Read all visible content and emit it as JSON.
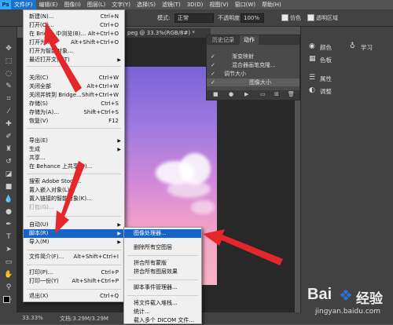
{
  "menubar": {
    "logo": "Ps",
    "items": [
      "文件(F)",
      "编辑(E)",
      "图像(I)",
      "图层(L)",
      "文字(Y)",
      "选择(S)",
      "滤镜(T)",
      "3D(D)",
      "视图(V)",
      "窗口(W)",
      "帮助(H)"
    ]
  },
  "optbar": {
    "mode_label": "模式:",
    "mode_value": "正常",
    "opacity_label": "不透明度:",
    "opacity_value": "100%",
    "protect_label": "仿色",
    "transparent_label": "透明区域"
  },
  "document_tab": "peg @ 33.3%(RGB/8#) *",
  "status": {
    "zoom": "33.33%",
    "doc": "文档:3.29M/3.29M"
  },
  "file_menu": [
    {
      "label": "新建(N)...",
      "shortcut": "Ctrl+N"
    },
    {
      "label": "打开(O)...",
      "shortcut": "Ctrl+O"
    },
    {
      "label": "在 Bridge 中浏览(B)...",
      "shortcut": "Alt+Ctrl+O"
    },
    {
      "label": "打开为...",
      "shortcut": "Alt+Shift+Ctrl+O"
    },
    {
      "label": "打开为智能对象...",
      "shortcut": ""
    },
    {
      "label": "最近打开文件(T)",
      "shortcut": "",
      "submenu": true
    },
    {
      "label": "关闭(C)",
      "shortcut": "Ctrl+W"
    },
    {
      "label": "关闭全部",
      "shortcut": "Alt+Ctrl+W"
    },
    {
      "label": "关闭并转到 Bridge...",
      "shortcut": "Shift+Ctrl+W"
    },
    {
      "label": "存储(S)",
      "shortcut": "Ctrl+S"
    },
    {
      "label": "存储为(A)...",
      "shortcut": "Shift+Ctrl+S"
    },
    {
      "label": "恢复(V)",
      "shortcut": "F12"
    },
    {
      "label": "导出(E)",
      "shortcut": "",
      "submenu": true
    },
    {
      "label": "生成",
      "shortcut": "",
      "submenu": true
    },
    {
      "label": "共享...",
      "shortcut": ""
    },
    {
      "label": "在 Behance 上共享(D)...",
      "shortcut": ""
    },
    {
      "label": "搜索 Adobe Stock...",
      "shortcut": ""
    },
    {
      "label": "置入嵌入对象(L)...",
      "shortcut": ""
    },
    {
      "label": "置入链接的智能对象(K)...",
      "shortcut": ""
    },
    {
      "label": "打包(G)...",
      "shortcut": "",
      "disabled": true
    },
    {
      "label": "自动(U)",
      "shortcut": "",
      "submenu": true
    },
    {
      "label": "脚本(R)",
      "shortcut": "",
      "submenu": true,
      "selected": true
    },
    {
      "label": "导入(M)",
      "shortcut": "",
      "submenu": true
    },
    {
      "label": "文件简介(F)...",
      "shortcut": "Alt+Shift+Ctrl+I"
    },
    {
      "label": "打印(P)...",
      "shortcut": "Ctrl+P"
    },
    {
      "label": "打印一份(Y)",
      "shortcut": "Alt+Shift+Ctrl+P"
    },
    {
      "label": "退出(X)",
      "shortcut": "Ctrl+Q"
    }
  ],
  "script_menu": [
    {
      "label": "图像处理器...",
      "selected": true
    },
    {
      "label": "删除所有空图层"
    },
    {
      "label": "拼合所有蒙版"
    },
    {
      "label": "拼合所有图层效果"
    },
    {
      "label": "脚本事件管理器..."
    },
    {
      "label": "将文件载入堆栈..."
    },
    {
      "label": "统计..."
    },
    {
      "label": "载入多个 DICOM 文件..."
    }
  ],
  "actions_panel": {
    "tabs": [
      "历史记录",
      "动作"
    ],
    "rows": [
      "渐变映射",
      "混合器画笔克隆...",
      "调节大小",
      "图像大小"
    ]
  },
  "right_panels": [
    "颜色",
    "色板",
    "属性",
    "调整",
    "学习"
  ],
  "watermark": {
    "brand": "Bai",
    "brand_cn": "经验",
    "url": "jingyan.baidu.com"
  },
  "colors": {
    "accent": "#1565c8",
    "arrow": "#e5262b"
  }
}
